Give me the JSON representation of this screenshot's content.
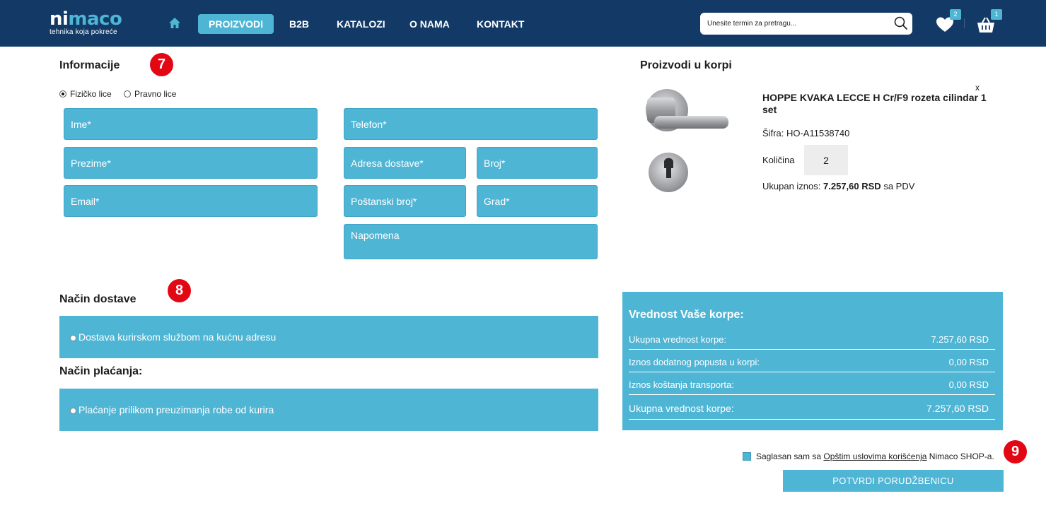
{
  "header": {
    "logo": {
      "name_part1": "ni",
      "name_part2": "maco",
      "tagline": "tehnika koja pokreće"
    },
    "nav": [
      {
        "label": "PROIZVODI"
      },
      {
        "label": "B2B"
      },
      {
        "label": "KATALOZI"
      },
      {
        "label": "O NAMA"
      },
      {
        "label": "KONTAKT"
      }
    ],
    "search": {
      "placeholder": "Unesite termin za pretragu..."
    },
    "wishlist_count": "2",
    "cart_count": "1",
    "colors": {
      "header_bg": "#133a66",
      "accent": "#4fb5d5"
    }
  },
  "info": {
    "title": "Informacije",
    "step": "7",
    "person_types": [
      "Fizičko lice",
      "Pravno lice"
    ],
    "selected_person_type": "Fizičko lice",
    "fields": {
      "first_name": "Ime*",
      "last_name": "Prezime*",
      "email": "Email*",
      "phone": "Telefon*",
      "address": "Adresa dostave*",
      "number": "Broj*",
      "postal": "Poštanski broj*",
      "city": "Grad*",
      "note": "Napomena"
    }
  },
  "shipping": {
    "title": "Način dostave",
    "step": "8",
    "option": "Dostava kurirskom službom na kućnu adresu"
  },
  "payment": {
    "title": "Način plaćanja:",
    "option": "Plaćanje prilikom preuzimanja robe od kurira"
  },
  "cart": {
    "title": "Proizvodi u korpi",
    "remove": "x",
    "product_name": "HOPPE KVAKA LECCE H Cr/F9 rozeta cilindar 1 set",
    "sku_label": "Šifra:",
    "sku": "HO-A11538740",
    "qty_label": "Količina",
    "qty": "2",
    "total_label": "Ukupan iznos:",
    "total_value": "7.257,60 RSD",
    "total_suffix": "sa PDV"
  },
  "summary": {
    "title": "Vrednost Vaše korpe:",
    "rows": [
      {
        "label": "Ukupna vrednost korpe:",
        "value": "7.257,60 RSD"
      },
      {
        "label": "Iznos dodatnog popusta u korpi:",
        "value": "0,00 RSD"
      },
      {
        "label": "Iznos koštanja transporta:",
        "value": "0,00 RSD"
      }
    ],
    "total": {
      "label": "Ukupna vrednost korpe:",
      "value": "7.257,60 RSD"
    }
  },
  "terms": {
    "prefix": "Saglasan sam sa",
    "link": "Opštim uslovima korišćenja",
    "suffix": "Nimaco SHOP-a.",
    "step": "9"
  },
  "submit_label": "POTVRDI PORUDŽBENICU"
}
